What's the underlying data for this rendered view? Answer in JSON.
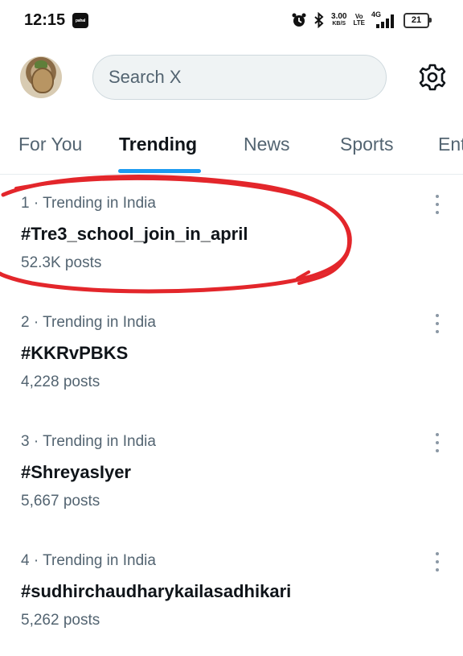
{
  "status_bar": {
    "time": "12:15",
    "app_badge": "pahal",
    "speed_value": "3.00",
    "speed_unit": "KB/S",
    "volte_top": "Vo",
    "volte_bottom": "LTE",
    "network": "4G",
    "battery": "21"
  },
  "header": {
    "avatar": "profile-avatar",
    "search_placeholder": "Search X",
    "settings_icon": "gear-icon"
  },
  "tabs": [
    {
      "label": "For You",
      "active": false
    },
    {
      "label": "Trending",
      "active": true
    },
    {
      "label": "News",
      "active": false
    },
    {
      "label": "Sports",
      "active": false
    },
    {
      "label": "Ent",
      "active": false
    }
  ],
  "trends": [
    {
      "meta": "1 · Trending in India",
      "tag": "#Tre3_school_join_in_april",
      "posts": "52.3K posts"
    },
    {
      "meta": "2 · Trending in India",
      "tag": "#KKRvPBKS",
      "posts": "4,228 posts"
    },
    {
      "meta": "3 · Trending in India",
      "tag": "#ShreyasIyer",
      "posts": "5,667 posts"
    },
    {
      "meta": "4 · Trending in India",
      "tag": "#sudhirchaudharykailasadhikari",
      "posts": "5,262 posts"
    }
  ],
  "colors": {
    "accent": "#1d9bf0",
    "annotation": "#e3262b",
    "secondary_text": "#536471"
  }
}
